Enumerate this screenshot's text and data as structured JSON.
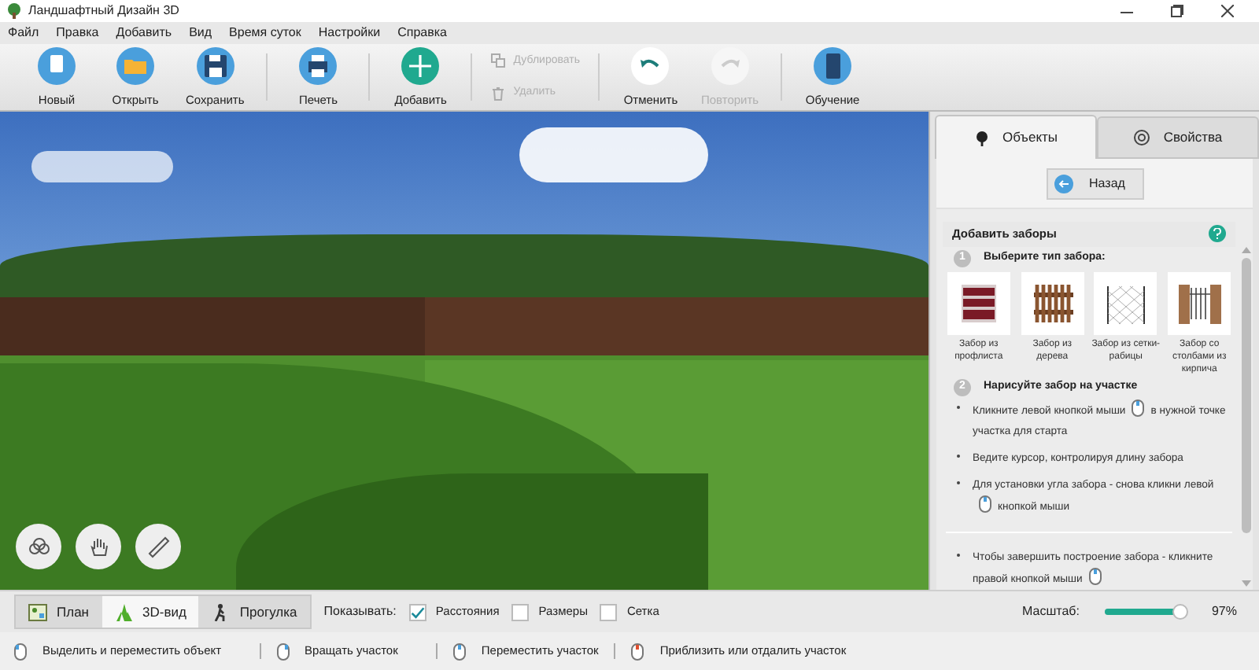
{
  "window": {
    "title": "Ландшафтный Дизайн 3D"
  },
  "menu": [
    "Файл",
    "Правка",
    "Добавить",
    "Вид",
    "Время суток",
    "Настройки",
    "Справка"
  ],
  "toolbar": [
    [
      {
        "kind": "big",
        "label": "Новый",
        "disabled": false
      },
      {
        "kind": "big",
        "label": "Открыть",
        "disabled": false
      },
      {
        "kind": "big",
        "label": "Сохранить",
        "disabled": false
      }
    ],
    [
      {
        "kind": "big",
        "label": "Печеть",
        "disabled": false
      }
    ],
    [
      {
        "kind": "big",
        "label": "Добавить",
        "disabled": false
      }
    ],
    [
      {
        "kind": "small",
        "label": "Дублировать",
        "disabled": true
      },
      {
        "kind": "small",
        "label": "Удалить",
        "disabled": true
      }
    ],
    [
      {
        "kind": "big",
        "label": "Отменить",
        "disabled": false
      },
      {
        "kind": "big",
        "label": "Повторить",
        "disabled": true
      }
    ],
    [
      {
        "kind": "big",
        "label": "Обучение",
        "disabled": false
      }
    ]
  ],
  "panel": {
    "tabs": [
      {
        "label": "Объекты",
        "selected": true
      },
      {
        "label": "Свойства",
        "selected": false
      }
    ],
    "back_button": "Назад",
    "section_title": "Добавить заборы",
    "step_1": {
      "number": "1",
      "title": "Выберите тип забора:"
    },
    "fence_types": [
      {
        "kind": "profile",
        "label": "Забор из профлиста"
      },
      {
        "kind": "wood",
        "label": "Забор из дерева"
      },
      {
        "kind": "mesh",
        "label": "Забор из сетки-рабицы"
      },
      {
        "kind": "brick",
        "label": "Забор со столбами из кирпича"
      }
    ],
    "step_2": {
      "number": "2",
      "title": "Нарисуйте забор на участке"
    },
    "instructions": [
      {
        "kind": "icon_between",
        "parts": [
          "Кликните левой кнопкой мыши",
          "в нужной точке участка для старта"
        ]
      },
      {
        "kind": "plain",
        "parts": [
          "Ведите курсор, контролируя длину забора"
        ]
      },
      {
        "kind": "icon_between",
        "parts": [
          "Для установки угла забора - снова кликни левой",
          "кнопкой мыши"
        ]
      }
    ],
    "final_instructions": [
      {
        "kind": "icon_end",
        "parts": [
          "Чтобы завершить построение забора - кликните правой кнопкой мыши"
        ]
      }
    ]
  },
  "view_modes": [
    {
      "label": "План",
      "selected": false
    },
    {
      "label": "3D-вид",
      "selected": true
    },
    {
      "label": "Прогулка",
      "selected": false
    }
  ],
  "show_label": "Показывать:",
  "show_options": [
    {
      "label": "Расстояния",
      "checked": true
    },
    {
      "label": "Размеры",
      "checked": false
    },
    {
      "label": "Сетка",
      "checked": false
    }
  ],
  "scale": {
    "label": "Масштаб:",
    "level": 0.97,
    "reading": "97%"
  },
  "status_hints": [
    "Выделить и переместить объект",
    "Вращать участок",
    "Переместить участок",
    "Приблизить или отдалить участок"
  ]
}
